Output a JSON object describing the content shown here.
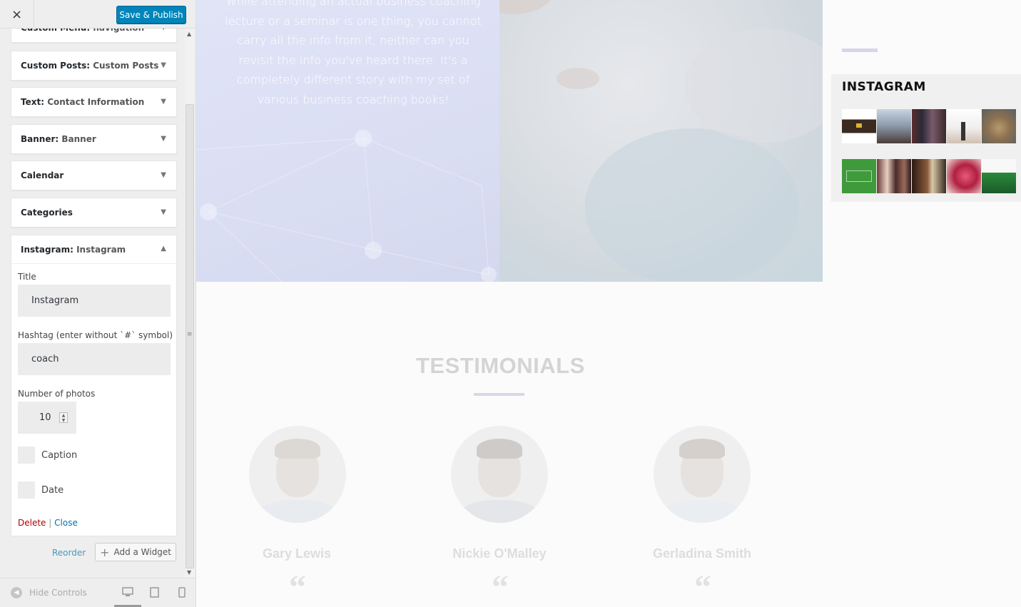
{
  "toolbar": {
    "close_icon": "×",
    "save_label": "Save & Publish"
  },
  "widgets": [
    {
      "type": "Custom Menu:",
      "name": "navigation"
    },
    {
      "type": "Custom Posts:",
      "name": "Custom Posts"
    },
    {
      "type": "Text:",
      "name": "Contact Information"
    },
    {
      "type": "Banner:",
      "name": "Banner"
    },
    {
      "type": "Calendar",
      "name": ""
    },
    {
      "type": "Categories",
      "name": ""
    }
  ],
  "open_widget": {
    "type": "Instagram:",
    "name": "Instagram",
    "title_label": "Title",
    "title_value": "Instagram",
    "hashtag_label": "Hashtag (enter without `#` symbol)",
    "hashtag_value": "coach",
    "photos_label": "Number of photos",
    "photos_value": "10",
    "caption_label": "Caption",
    "date_label": "Date",
    "delete_label": "Delete",
    "separator": "|",
    "close_label": "Close"
  },
  "panel_actions": {
    "reorder_label": "Reorder",
    "add_widget_label": "Add a Widget"
  },
  "footer": {
    "hide_controls_label": "Hide Controls",
    "devices": [
      "desktop-icon",
      "tablet-icon",
      "mobile-icon"
    ]
  },
  "preview": {
    "hero_text": "While attending an actual business coaching lecture or a seminar is one thing, you cannot carry all the info from it, neither can you revisit the info you've heard there. It's a completely different story with my set of various business coaching books!",
    "instagram_title": "INSTAGRAM",
    "testimonials_heading": "TESTIMONIALS",
    "people": [
      {
        "name": "Gary Lewis"
      },
      {
        "name": "Nickie O'Malley"
      },
      {
        "name": "Gerladina Smith"
      }
    ],
    "quote_glyph": "“"
  },
  "colors": {
    "accent_blue": "#0085ba",
    "link_blue": "#0073aa",
    "delete_red": "#a00",
    "hero_lavender": "#dadef3"
  }
}
